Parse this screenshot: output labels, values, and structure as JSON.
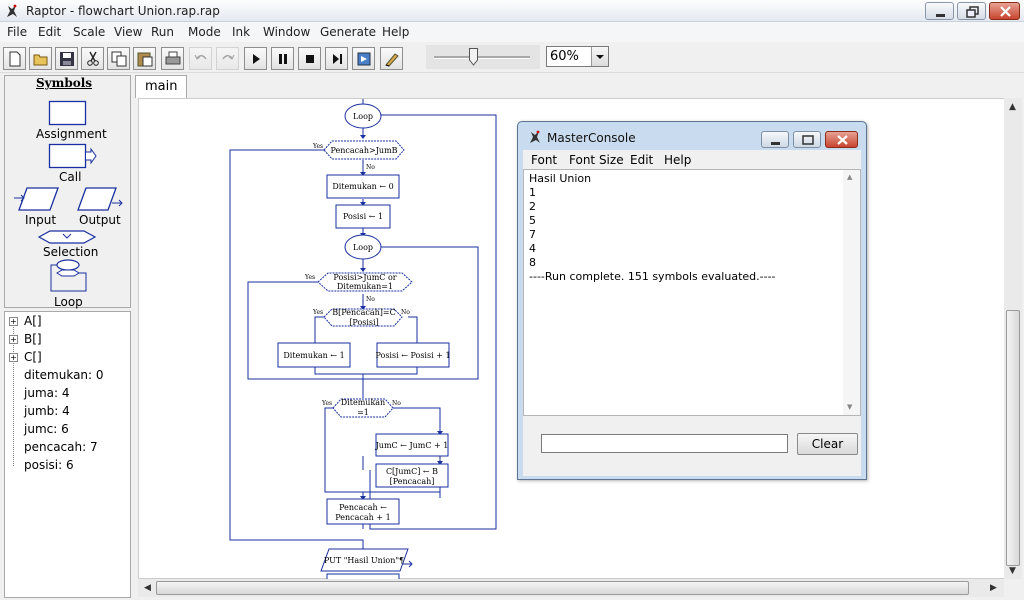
{
  "window": {
    "title": "Raptor - flowchart Union.rap.rap"
  },
  "menu": [
    "File",
    "Edit",
    "Scale",
    "View",
    "Run",
    "Mode",
    "Ink",
    "Window",
    "Generate",
    "Help"
  ],
  "toolbar": {
    "zoom": "60%"
  },
  "symbols": {
    "title": "Symbols",
    "assignment": "Assignment",
    "call": "Call",
    "input": "Input",
    "output": "Output",
    "selection": "Selection",
    "loop": "Loop"
  },
  "variables": {
    "arrays": [
      "A[]",
      "B[]",
      "C[]"
    ],
    "items": [
      "ditemukan: 0",
      "juma: 4",
      "jumb: 4",
      "jumc: 6",
      "pencacah: 7",
      "posisi: 6"
    ]
  },
  "tab": {
    "main": "main"
  },
  "flowchart": {
    "loop": "Loop",
    "yes": "Yes",
    "no": "No",
    "cond_outer": "Pencacah>JumB",
    "assign_ditemukan0": "Ditemukan ← 0",
    "assign_posisi1": "Posisi ← 1",
    "cond_inner_1": "Posisi>JumC or",
    "cond_inner_2": "Ditemukan=1",
    "cond_sel_1": "B[Pencacah]=C",
    "cond_sel_2": "[Posisi]",
    "assign_ditemukan1": "Ditemukan ← 1",
    "assign_posisi_inc": "Posisi ← Posisi + 1",
    "cond_found_1": "Ditemukan",
    "cond_found_2": "=1",
    "assign_jumc": "JumC ← JumC + 1",
    "assign_c_1": "C[JumC] ← B",
    "assign_c_2": "[Pencacah]",
    "assign_pencacah_1": "Pencacah ←",
    "assign_pencacah_2": "Pencacah + 1",
    "put": "PUT \"Hasil Union\"¶"
  },
  "console": {
    "title": "MasterConsole",
    "menu": [
      "Font",
      "Font Size",
      "Edit",
      "Help"
    ],
    "output": [
      "Hasil Union",
      "1",
      "2",
      "5",
      "7",
      "4",
      "8",
      "----Run complete.  151 symbols evaluated.----"
    ],
    "clear": "Clear",
    "input_value": ""
  }
}
